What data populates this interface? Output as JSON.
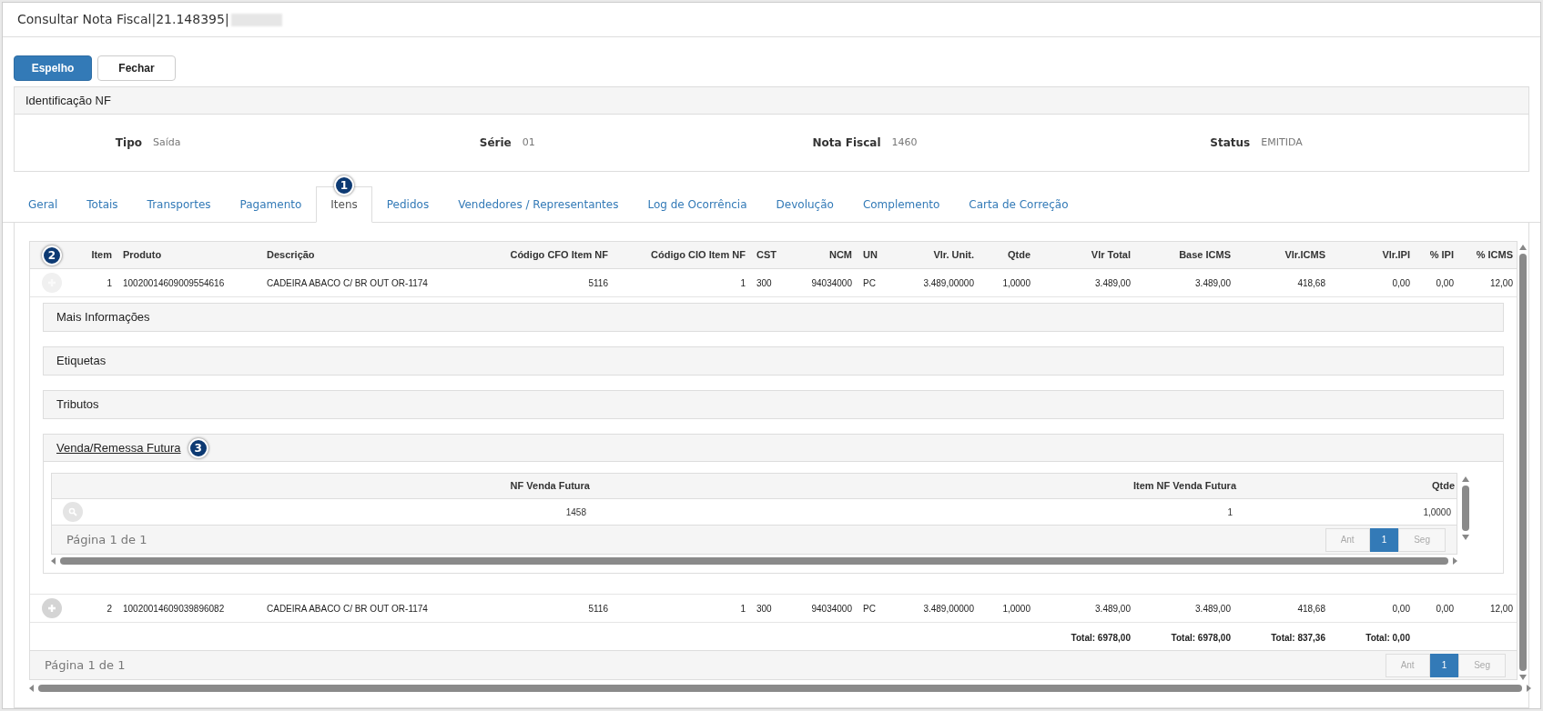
{
  "window": {
    "title": "Consultar Nota Fiscal|21.148395|"
  },
  "buttons": [
    {
      "label": "Espelho",
      "primary": true
    },
    {
      "label": "Fechar",
      "primary": false
    }
  ],
  "identification": {
    "title": "Identificação NF",
    "fields": [
      {
        "label": "Tipo",
        "value": "Saída"
      },
      {
        "label": "Série",
        "value": "01"
      },
      {
        "label": "Nota Fiscal",
        "value": "1460"
      },
      {
        "label": "Status",
        "value": "EMITIDA"
      }
    ]
  },
  "tabs": [
    {
      "label": "Geral",
      "selected": false
    },
    {
      "label": "Totais",
      "selected": false
    },
    {
      "label": "Transportes",
      "selected": false
    },
    {
      "label": "Pagamento",
      "selected": false
    },
    {
      "label": "Itens",
      "selected": true,
      "callout": "1"
    },
    {
      "label": "Pedidos",
      "selected": false
    },
    {
      "label": "Vendedores / Representantes",
      "selected": false
    },
    {
      "label": "Log de Ocorrência",
      "selected": false
    },
    {
      "label": "Devolução",
      "selected": false
    },
    {
      "label": "Complemento",
      "selected": false
    },
    {
      "label": "Carta de Correção",
      "selected": false
    }
  ],
  "table": {
    "expand_callout": "2",
    "columns": [
      {
        "label": "Item"
      },
      {
        "label": "Produto"
      },
      {
        "label": "Descrição"
      },
      {
        "label": "Código CFO Item NF"
      },
      {
        "label": "Código CIO Item NF"
      },
      {
        "label": "CST"
      },
      {
        "label": "NCM"
      },
      {
        "label": "UN"
      },
      {
        "label": "Vlr. Unit."
      },
      {
        "label": "Qtde"
      },
      {
        "label": "Vlr Total",
        "total": "Total: 6978,00"
      },
      {
        "label": "Base ICMS",
        "total": "Total: 6978,00"
      },
      {
        "label": "Vlr.ICMS",
        "total": "Total: 837,36"
      },
      {
        "label": "Vlr.IPI",
        "total": "Total: 0,00"
      },
      {
        "label": "% IPI"
      },
      {
        "label": "% ICMS"
      }
    ],
    "rows": [
      {
        "expanded": true,
        "cells": [
          "1",
          "10020014609009554616",
          "CADEIRA ABACO C/ BR OUT OR-1174",
          "5116",
          "1",
          "300",
          "94034000",
          "PC",
          "3.489,00000",
          "1,0000",
          "3.489,00",
          "3.489,00",
          "418,68",
          "0,00",
          "0,00",
          "12,00"
        ],
        "details": [
          {
            "title": "Mais Informações",
            "expanded": false
          },
          {
            "title": "Etiquetas",
            "expanded": false
          },
          {
            "title": "Tributos",
            "expanded": false
          },
          {
            "title": "Venda/Remessa Futura",
            "expanded": true,
            "callout": "3",
            "subtable": {
              "columns": [
                "NF Venda Futura",
                "Item NF Venda Futura",
                "Qtde"
              ],
              "rows": [
                [
                  "1458",
                  "1",
                  "1,0000"
                ]
              ],
              "pager": {
                "label": "Página 1 de 1",
                "prev": "Ant",
                "next": "Seg",
                "pages": [
                  {
                    "label": "1",
                    "selected": true
                  }
                ]
              }
            }
          }
        ]
      },
      {
        "expanded": false,
        "cells": [
          "2",
          "10020014609039896082",
          "CADEIRA ABACO C/ BR OUT OR-1174",
          "5116",
          "1",
          "300",
          "94034000",
          "PC",
          "3.489,00000",
          "1,0000",
          "3.489,00",
          "3.489,00",
          "418,68",
          "0,00",
          "0,00",
          "12,00"
        ]
      }
    ],
    "pager": {
      "label": "Página 1 de 1",
      "prev": "Ant",
      "next": "Seg",
      "pages": [
        {
          "label": "1",
          "selected": true
        }
      ]
    }
  }
}
